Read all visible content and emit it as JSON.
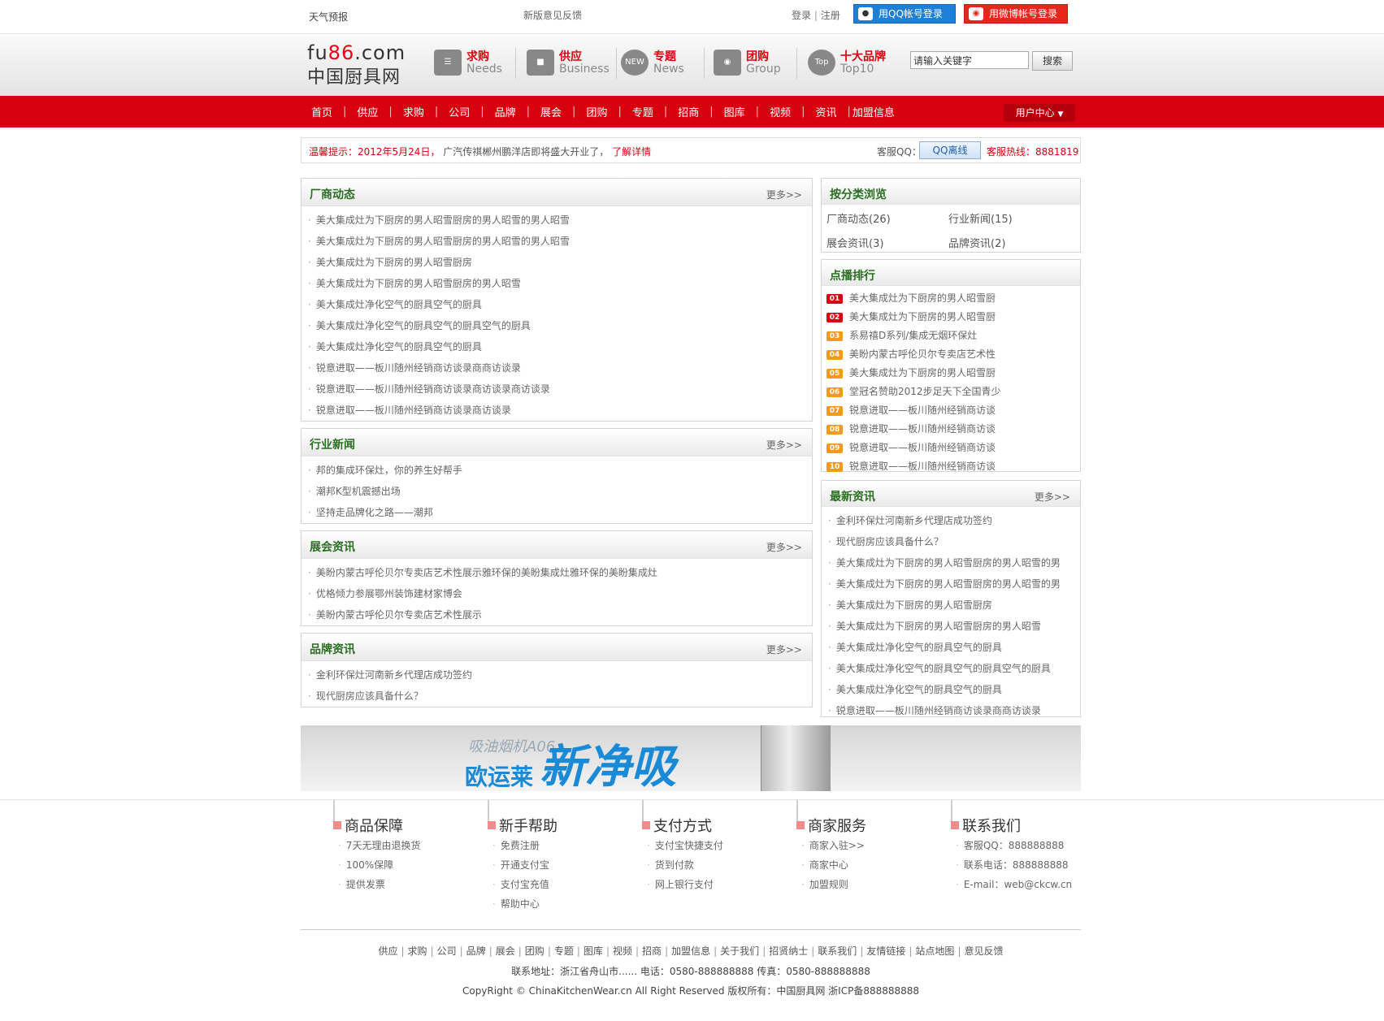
{
  "topbar": {
    "weather": "天气预报",
    "feedback": "新版意见反馈",
    "login": "登录",
    "register": "注册",
    "qq_login": "用QQ帐号登录",
    "weibo_login": "用微博帐号登录"
  },
  "logo": {
    "line1_pre": "fu",
    "line1_num": "86",
    "line1_post": ".com",
    "line2": "中国厨具网"
  },
  "nav_blocks": [
    {
      "cn": "求购",
      "en": "Needs",
      "icon": "document-icon"
    },
    {
      "cn": "供应",
      "en": "Business",
      "icon": "basket-icon"
    },
    {
      "cn": "专题",
      "en": "News",
      "icon": "new-badge-icon"
    },
    {
      "cn": "团购",
      "en": "Group",
      "icon": "camera-icon"
    },
    {
      "cn": "十大品牌",
      "en": "Top10",
      "icon": "top-badge-icon"
    }
  ],
  "search": {
    "placeholder": "请输入关键字",
    "button": "搜索"
  },
  "main_nav": [
    "首页",
    "供应",
    "求购",
    "公司",
    "品牌",
    "展会",
    "团购",
    "专题",
    "招商",
    "图库",
    "视频",
    "资讯",
    "加盟信息"
  ],
  "user_center": "用户中心",
  "notice": {
    "label": "温馨提示：2012年5月24日，",
    "text": "广汽传祺郴州鹏洋店即将盛大开业了，",
    "link": "了解详情",
    "service_qq_label": "客服QQ：",
    "qq_status": "QQ离线",
    "hotline": "客服热线：8881819"
  },
  "more": "更多>>",
  "sections": {
    "factory": {
      "title": "厂商动态",
      "items": [
        "美大集成灶为下厨房的男人昭雪厨房的男人昭雪的男人昭雪",
        "美大集成灶为下厨房的男人昭雪厨房的男人昭雪的男人昭雪",
        "美大集成灶为下厨房的男人昭雪厨房",
        "美大集成灶为下厨房的男人昭雪厨房的男人昭雪",
        "美大集成灶净化空气的厨具空气的厨具",
        "美大集成灶净化空气的厨具空气的厨具空气的厨具",
        "美大集成灶净化空气的厨具空气的厨具",
        "锐意进取——板川随州经销商访谈录商商访谈录",
        "锐意进取——板川随州经销商访谈录商访谈录商访谈录",
        "锐意进取——板川随州经销商访谈录商访谈录"
      ]
    },
    "industry": {
      "title": "行业新闻",
      "items": [
        "邦的集成环保灶，你的养生好帮手",
        "潮邦K型机震撼出场",
        "坚持走品牌化之路——潮邦"
      ]
    },
    "expo": {
      "title": "展会资讯",
      "items": [
        "美盼内蒙古呼伦贝尔专卖店艺术性展示雅环保的美盼集成灶雅环保的美盼集成灶",
        "优格倾力参展鄂州装饰建材家博会",
        "美盼内蒙古呼伦贝尔专卖店艺术性展示"
      ]
    },
    "brand": {
      "title": "品牌资讯",
      "items": [
        "金利环保灶河南新乡代理店成功签约",
        "现代厨房应该具备什么？"
      ]
    }
  },
  "categories": {
    "title": "按分类浏览",
    "items": [
      "厂商动态(26)",
      "行业新闻(15)",
      "展会资讯(3)",
      "品牌资讯(2)"
    ]
  },
  "ranking": {
    "title": "点播排行",
    "items": [
      {
        "num": "01",
        "text": "美大集成灶为下厨房的男人昭雪厨"
      },
      {
        "num": "02",
        "text": "美大集成灶为下厨房的男人昭雪厨"
      },
      {
        "num": "03",
        "text": "系易禧D系列/集成无烟环保灶"
      },
      {
        "num": "04",
        "text": "美盼内蒙古呼伦贝尔专卖店艺术性"
      },
      {
        "num": "05",
        "text": "美大集成灶为下厨房的男人昭雪厨"
      },
      {
        "num": "06",
        "text": "堂冠名赞助2012步足天下全国青少"
      },
      {
        "num": "07",
        "text": "锐意进取——板川随州经销商访谈"
      },
      {
        "num": "08",
        "text": "锐意进取——板川随州经销商访谈"
      },
      {
        "num": "09",
        "text": "锐意进取——板川随州经销商访谈"
      },
      {
        "num": "10",
        "text": "锐意进取——板川随州经销商访谈"
      }
    ],
    "top_color": "#d7000f",
    "rest_color": "#f39a1e"
  },
  "latest": {
    "title": "最新资讯",
    "items": [
      "金利环保灶河南新乡代理店成功签约",
      "现代厨房应该具备什么？",
      "美大集成灶为下厨房的男人昭雪厨房的男人昭雪的男",
      "美大集成灶为下厨房的男人昭雪厨房的男人昭雪的男",
      "美大集成灶为下厨房的男人昭雪厨房",
      "美大集成灶为下厨房的男人昭雪厨房的男人昭雪",
      "美大集成灶净化空气的厨具空气的厨具",
      "美大集成灶净化空气的厨具空气的厨具空气的厨具",
      "美大集成灶净化空气的厨具空气的厨具",
      "锐意进取——板川随州经销商访谈录商商访谈录"
    ]
  },
  "banner": {
    "small": "吸油烟机A06",
    "brand": "欧运莱",
    "slogan": "新净吸"
  },
  "footer_cols": [
    {
      "title": "商品保障",
      "items": [
        "7天无理由退换货",
        "100%保障",
        "提供发票"
      ]
    },
    {
      "title": "新手帮助",
      "items": [
        "免费注册",
        "开通支付宝",
        "支付宝充值",
        "帮助中心"
      ]
    },
    {
      "title": "支付方式",
      "items": [
        "支付宝快捷支付",
        "货到付款",
        "网上银行支付"
      ]
    },
    {
      "title": "商家服务",
      "items": [
        "商家入驻>>",
        "商家中心",
        "加盟规则"
      ]
    },
    {
      "title": "联系我们",
      "items": [
        "客服QQ：888888888",
        "联系电话：888888888",
        "E-mail：web@ckcw.cn"
      ]
    }
  ],
  "footer_links": [
    "供应",
    "求购",
    "公司",
    "品牌",
    "展会",
    "团购",
    "专题",
    "图库",
    "视频",
    "招商",
    "加盟信息",
    "关于我们",
    "招贤纳士",
    "联系我们",
    "友情链接",
    "站点地图",
    "意见反馈"
  ],
  "footer_address": "联系地址：浙江省舟山市...... 电话：0580-888888888 传真：0580-888888888",
  "footer_copyright": "CopyRight © ChinaKitchenWear.cn All Right Reserved 版权所有：中国厨具网 浙ICP备888888888",
  "colors": {
    "brand_red": "#d7000f",
    "title_green": "#2a6e22"
  }
}
